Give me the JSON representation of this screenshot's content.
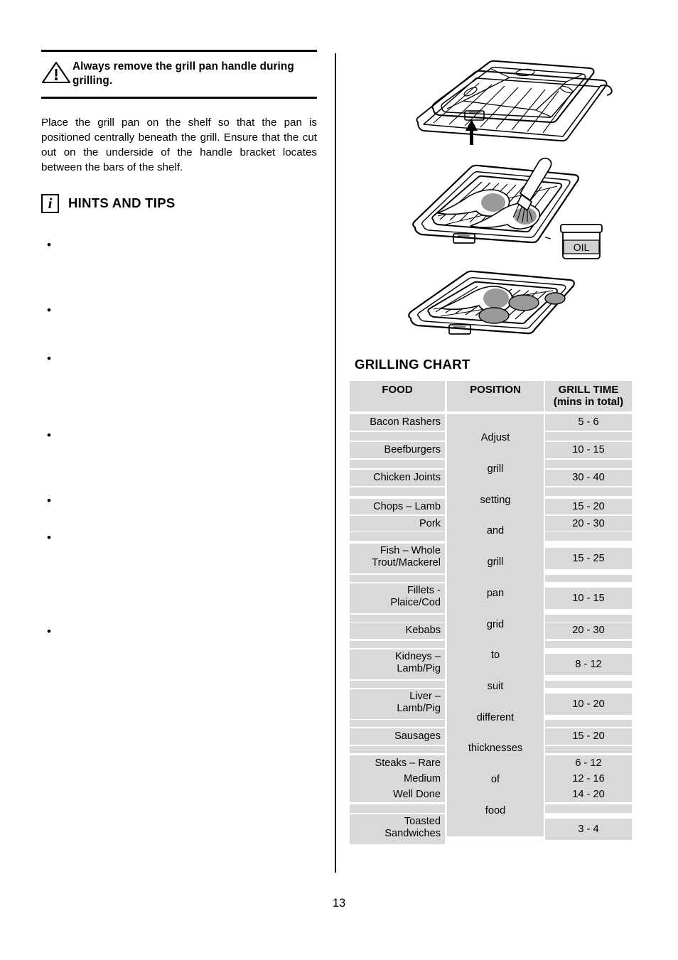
{
  "page": {
    "number": "13"
  },
  "warning": {
    "icon": "warning-triangle-icon",
    "text": "Always remove the grill pan handle during grilling."
  },
  "instruction": {
    "text": "Place the grill pan on the shelf so that the pan is positioned centrally beneath the grill.  Ensure that the cut out on the underside of the handle bracket locates between the bars of the shelf."
  },
  "hints": {
    "icon": "info-icon",
    "title": "HINTS AND TIPS",
    "items": [
      {
        "text": ""
      },
      {
        "text": ""
      },
      {
        "text": ""
      },
      {
        "text": ""
      },
      {
        "text": ""
      },
      {
        "text": ""
      },
      {
        "text": ""
      }
    ]
  },
  "illustrations": [
    {
      "name": "grill-pan-on-shelf-illustration",
      "caption": "",
      "labels": []
    },
    {
      "name": "grill-pan-with-brush-and-oil-illustration",
      "caption": "",
      "labels": [
        "OIL"
      ]
    },
    {
      "name": "grill-pan-with-food-on-grid-illustration",
      "caption": "",
      "labels": []
    }
  ],
  "grilling_chart": {
    "title": "GRILLING CHART",
    "columns": [
      {
        "label": "FOOD"
      },
      {
        "label": "POSITION"
      },
      {
        "label": "GRILL TIME",
        "sublabel": "(mins in total)"
      }
    ],
    "position_words": [
      "Adjust",
      "grill",
      "setting",
      "and",
      "grill",
      "pan",
      "grid",
      "to",
      "suit",
      "different",
      "thicknesses",
      "of",
      "food"
    ],
    "rows": [
      {
        "food": [
          "Bacon Rashers"
        ],
        "time": "5 - 6"
      },
      {
        "food": [
          "Beefburgers"
        ],
        "time": "10 - 15"
      },
      {
        "food": [
          "Chicken Joints"
        ],
        "time": "30 - 40"
      },
      {
        "food": [
          "Chops – Lamb"
        ],
        "time": "15 - 20"
      },
      {
        "food": [
          "Pork"
        ],
        "time": "20 - 30"
      },
      {
        "food": [
          "Fish – Whole",
          "Trout/Mackerel"
        ],
        "time": "15 - 25"
      },
      {
        "food": [
          "Fillets -",
          "Plaice/Cod"
        ],
        "time": "10 - 15"
      },
      {
        "food": [
          "Kebabs"
        ],
        "time": "20 - 30"
      },
      {
        "food": [
          "Kidneys –",
          "Lamb/Pig"
        ],
        "time": "8 - 12"
      },
      {
        "food": [
          "Liver –",
          "Lamb/Pig"
        ],
        "time": "10 - 20"
      },
      {
        "food": [
          "Sausages"
        ],
        "time": "15 - 20"
      },
      {
        "food": [
          "Steaks – Rare"
        ],
        "time": "6 - 12"
      },
      {
        "food": [
          "Medium"
        ],
        "time": "12 - 16"
      },
      {
        "food": [
          "Well Done"
        ],
        "time": "14 - 20"
      },
      {
        "food": [
          "Toasted",
          "Sandwiches"
        ],
        "time": "3 - 4"
      }
    ]
  },
  "colors": {
    "cell_fill": "#d9d9d9",
    "text": "#000000",
    "rule": "#000000"
  }
}
